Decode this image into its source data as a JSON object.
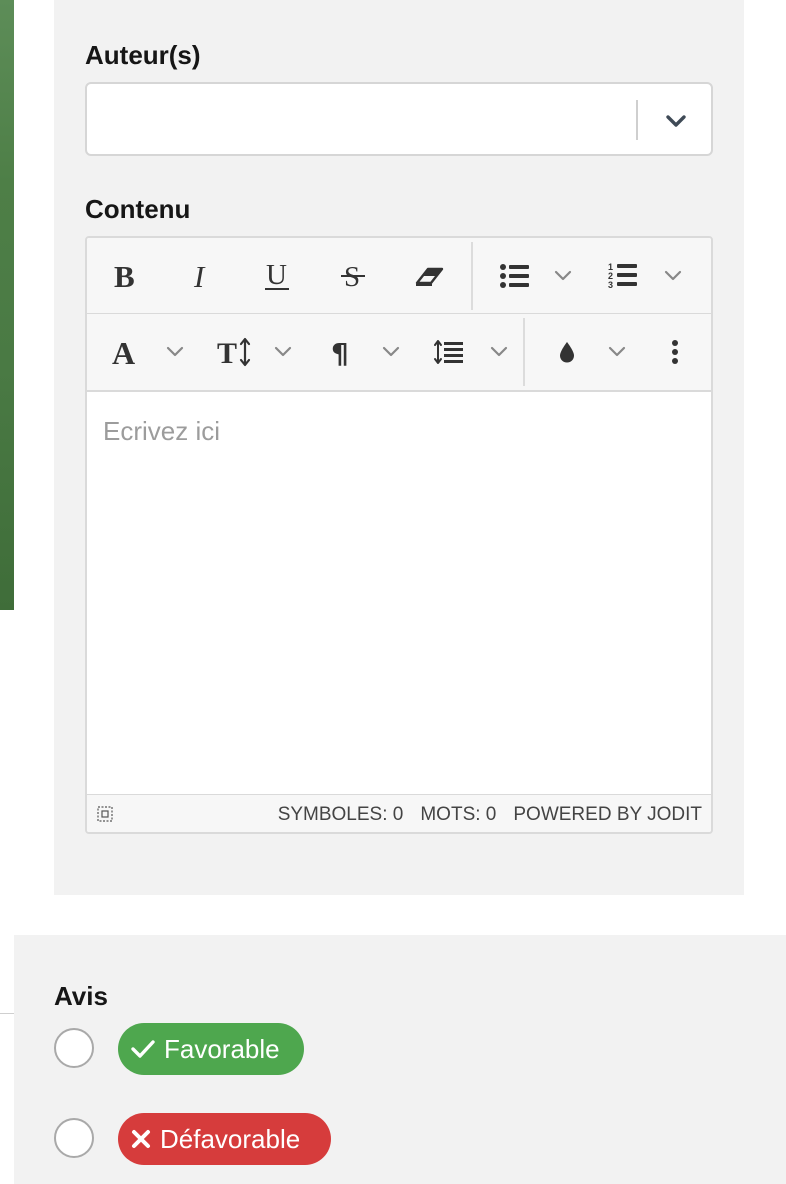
{
  "form": {
    "authors_label": "Auteur(s)",
    "authors_value": "",
    "content_label": "Contenu"
  },
  "editor": {
    "placeholder": "Ecrivez ici",
    "toolbar_row1": [
      "bold",
      "italic",
      "underline",
      "strikethrough",
      "eraser",
      "unordered-list",
      "ordered-list"
    ],
    "toolbar_row2": [
      "font",
      "font-size",
      "paragraph",
      "line-height",
      "brush",
      "more"
    ],
    "status": {
      "symbols": "SYMBOLES: 0",
      "words": "MOTS: 0",
      "powered": "POWERED BY JODIT"
    }
  },
  "avis": {
    "label": "Avis",
    "options": [
      {
        "label": "Favorable",
        "color": "#4ea74e",
        "icon": "check-icon",
        "selected": false
      },
      {
        "label": "Défavorable",
        "color": "#d63c3c",
        "icon": "cross-icon",
        "selected": false
      }
    ]
  },
  "colors": {
    "accent_green": "#4e7f47",
    "card_bg": "#f2f2f2"
  }
}
